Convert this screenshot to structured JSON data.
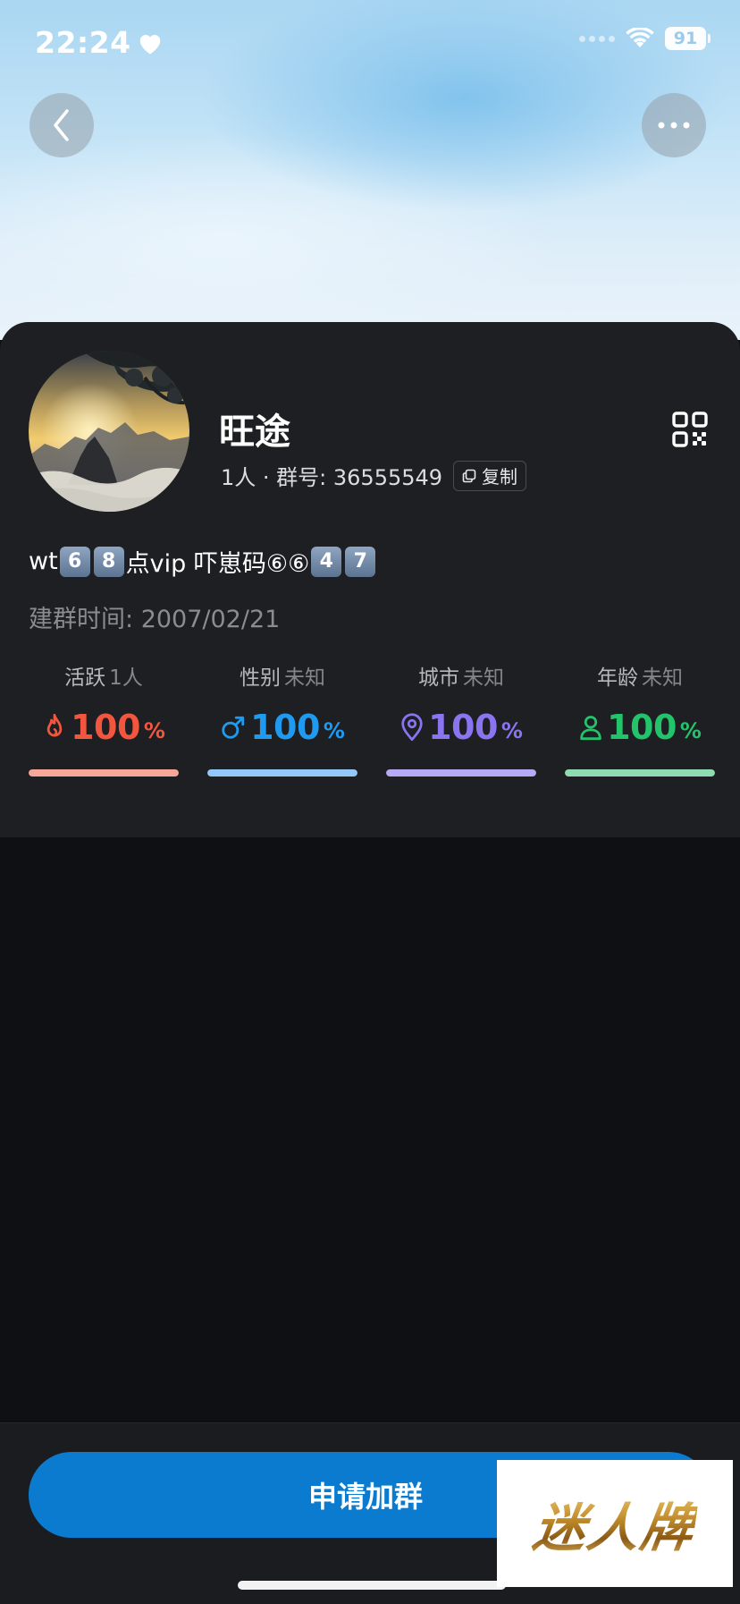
{
  "status_bar": {
    "time": "22:24",
    "battery": "91",
    "icons": [
      "heart-icon",
      "cellular-signal-icon",
      "wifi-icon",
      "battery-icon"
    ]
  },
  "nav": {
    "back_icon": "chevron-left-icon",
    "more_icon": "more-horizontal-icon"
  },
  "group": {
    "name": "旺途",
    "members": "1人",
    "separator": " · ",
    "id_label": "群号: ",
    "id": "36555549",
    "copy_label": "复制",
    "description": {
      "prefix": "wt",
      "keycaps_a": [
        "6",
        "8"
      ],
      "middle": "点vip 吓崽码⑥⑥",
      "keycaps_b": [
        "4",
        "7"
      ]
    },
    "created_label": "建群时间: ",
    "created_date": "2007/02/21"
  },
  "stats": [
    {
      "label": "活跃",
      "value": "1人",
      "number": "100",
      "unit": "%",
      "fill": 1.0,
      "icon": "flame-icon",
      "color": "#f2563f",
      "bar_color": "#f7a79a"
    },
    {
      "label": "性别",
      "value": "未知",
      "number": "100",
      "unit": "%",
      "fill": 1.0,
      "icon": "male-icon",
      "color": "#1e9bf0",
      "bar_color": "#93c8f8"
    },
    {
      "label": "城市",
      "value": "未知",
      "number": "100",
      "unit": "%",
      "fill": 1.0,
      "icon": "location-pin-icon",
      "color": "#8b74f0",
      "bar_color": "#b8a9f5"
    },
    {
      "label": "年龄",
      "value": "未知",
      "number": "100",
      "unit": "%",
      "fill": 1.0,
      "icon": "person-icon",
      "color": "#22c36a",
      "bar_color": "#8fdcb0"
    }
  ],
  "actions": {
    "join_label": "申请加群"
  },
  "watermark": {
    "text": "迷人牌"
  },
  "colors": {
    "card_bg": "#1e1f22",
    "page_bg": "#0f1013",
    "primary_button": "#0b7bd0"
  }
}
